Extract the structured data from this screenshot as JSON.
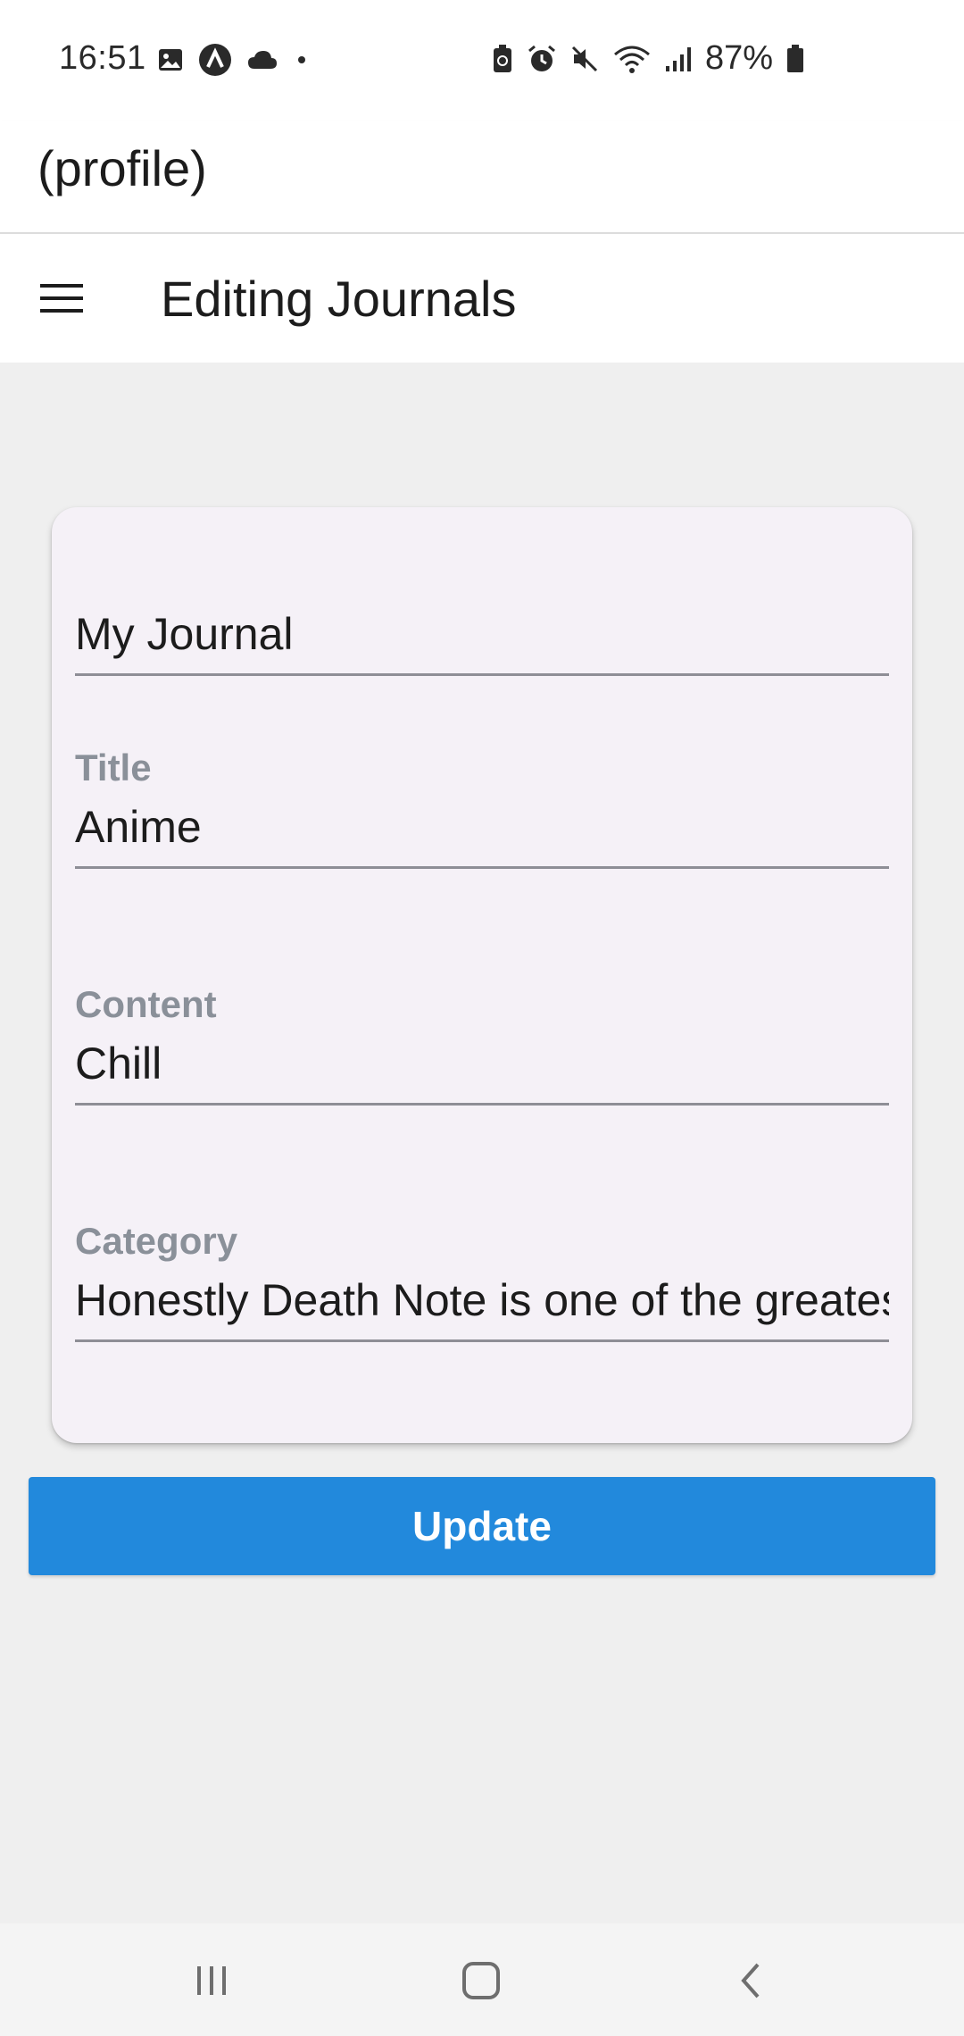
{
  "status_bar": {
    "time": "16:51",
    "left_icons": [
      "gallery-icon",
      "app-a-icon",
      "cloud-icon",
      "dot-icon"
    ],
    "right_icons": [
      "battery-saver-icon",
      "alarm-icon",
      "mute-icon",
      "wifi-icon",
      "signal-icon"
    ],
    "battery_percent": "87%"
  },
  "header": {
    "title": "(profile)"
  },
  "app_bar": {
    "menu_icon": "hamburger-menu-icon",
    "title": "Editing Journals"
  },
  "form": {
    "journal": {
      "value": "My Journal"
    },
    "title_field": {
      "label": "Title",
      "value": "Anime"
    },
    "content_field": {
      "label": "Content",
      "value": "Chill"
    },
    "category_field": {
      "label": "Category",
      "value": "Honestly Death Note is one of the greatest"
    },
    "submit_label": "Update"
  },
  "nav_bar": {
    "items": [
      "recent-apps-icon",
      "home-icon",
      "back-icon"
    ]
  },
  "colors": {
    "accent": "#2289dc",
    "card_bg": "#f5f1f7",
    "label": "#8a9099",
    "page_bg": "#efefef"
  }
}
